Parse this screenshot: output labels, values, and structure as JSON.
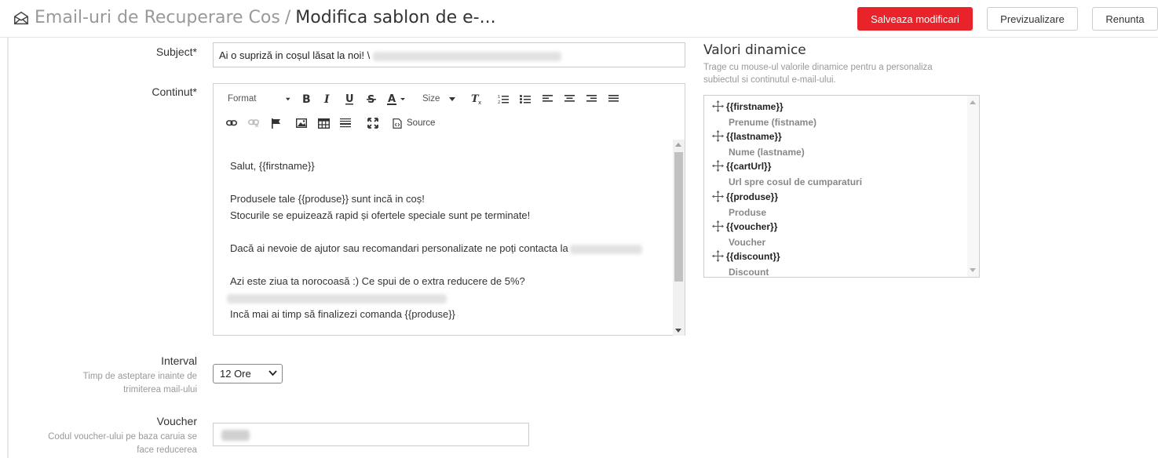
{
  "header": {
    "title_parent": "Email-uri de Recuperare Cos",
    "title_separator": "/",
    "title_current": "Modifica sablon de e-...",
    "save_label": "Salveaza modificari",
    "preview_label": "Previzualizare",
    "cancel_label": "Renunta",
    "accent_color": "#e8232a"
  },
  "form": {
    "subject": {
      "label": "Subject*",
      "value": "Ai o supriză in coșul lăsat la noi! \\"
    },
    "content": {
      "label": "Continut*",
      "toolbar": {
        "format_label": "Format",
        "size_label": "Size",
        "source_label": "Source"
      },
      "body": {
        "line1": "Salut, {{firstname}}",
        "line2": "Produsele tale {{produse}} sunt incă in coș!",
        "line3": "Stocurile se epuizează rapid și ofertele speciale sunt pe terminate!",
        "line4": "Dacă ai nevoie de ajutor sau recomandari personalizate ne poți contacta la",
        "line5": "Azi este ziua ta norocoasă :) Ce spui de o extra reducere de 5%?",
        "line6": "Incă mai ai timp să finalizezi comanda {{produse}}"
      }
    },
    "interval": {
      "label": "Interval",
      "help": "Timp de asteptare inainte de trimiterea mail-ului",
      "value": "12 Ore"
    },
    "voucher": {
      "label": "Voucher",
      "help": "Codul voucher-ului pe baza caruia se face reducerea"
    }
  },
  "dynamic": {
    "title": "Valori dinamice",
    "description": "Trage cu mouse-ul valorile dinamice pentru a personaliza subiectul si continutul e-mail-ului.",
    "items": [
      {
        "tag": "{{firstname}}",
        "desc": "Prenume (fistname)"
      },
      {
        "tag": "{{lastname}}",
        "desc": "Nume (lastname)"
      },
      {
        "tag": "{{cartUrl}}",
        "desc": "Url spre cosul de cumparaturi"
      },
      {
        "tag": "{{produse}}",
        "desc": "Produse"
      },
      {
        "tag": "{{voucher}}",
        "desc": "Voucher"
      },
      {
        "tag": "{{discount}}",
        "desc": "Discount"
      }
    ]
  },
  "icons": [
    "envelope-open-icon",
    "bold-icon",
    "italic-icon",
    "underline-icon",
    "strike-icon",
    "text-color-icon",
    "clear-format-icon",
    "numbered-list-icon",
    "bulleted-list-icon",
    "align-left-icon",
    "align-center-icon",
    "align-right-icon",
    "justify-icon",
    "link-icon",
    "unlink-icon",
    "flag-icon",
    "image-icon",
    "table-icon",
    "horizontal-rule-icon",
    "maximize-icon",
    "source-icon",
    "move-icon",
    "chevron-down-icon"
  ]
}
